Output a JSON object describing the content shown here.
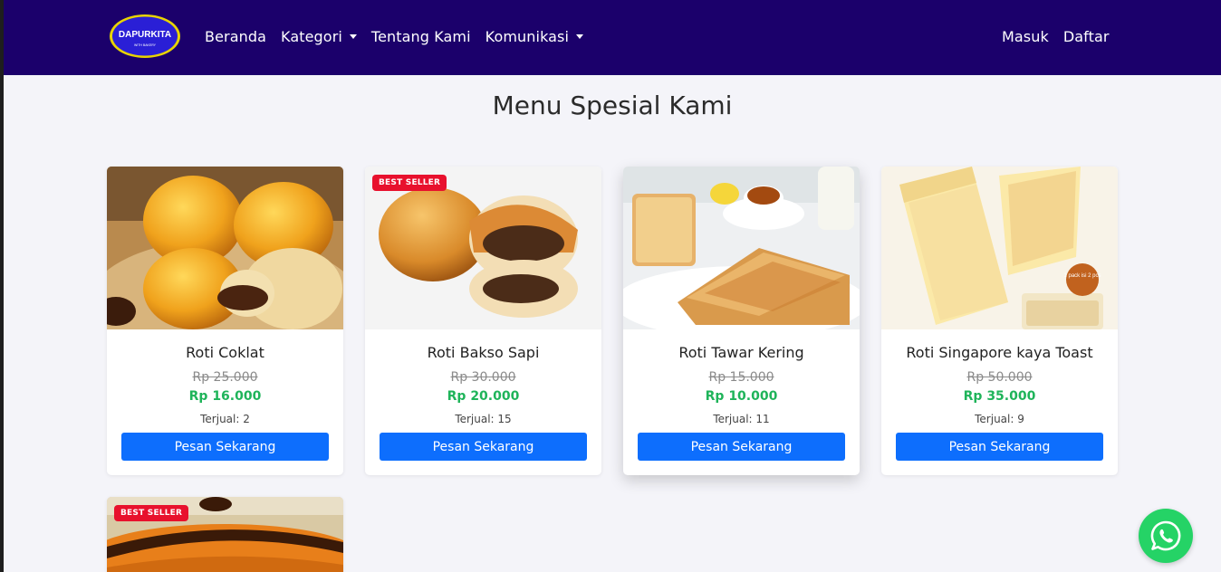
{
  "nav": {
    "logo_text": "DAPURKITA",
    "logo_sub": "WITH BAKERY",
    "links": [
      {
        "label": "Beranda"
      },
      {
        "label": "Kategori"
      },
      {
        "label": "Tentang Kami"
      },
      {
        "label": "Komunikasi"
      }
    ],
    "login": "Masuk",
    "register": "Daftar"
  },
  "page": {
    "title": "Menu Spesial Kami"
  },
  "products": [
    {
      "name": "Roti Coklat",
      "old_price": "Rp 25.000",
      "price": "Rp 16.000",
      "sold": "Terjual: 2",
      "button": "Pesan Sekarang",
      "badge": ""
    },
    {
      "name": "Roti Bakso Sapi",
      "old_price": "Rp 30.000",
      "price": "Rp 20.000",
      "sold": "Terjual: 15",
      "button": "Pesan Sekarang",
      "badge": "BEST SELLER"
    },
    {
      "name": "Roti Tawar Kering",
      "old_price": "Rp 15.000",
      "price": "Rp 10.000",
      "sold": "Terjual: 11",
      "button": "Pesan Sekarang",
      "badge": ""
    },
    {
      "name": "Roti Singapore kaya Toast",
      "old_price": "Rp 50.000",
      "price": "Rp 35.000",
      "sold": "Terjual: 9",
      "button": "Pesan Sekarang",
      "badge": ""
    },
    {
      "badge": "BEST SELLER"
    }
  ],
  "product_image_text": {
    "pack_label": "1 pack isi 2 pcs"
  },
  "colors": {
    "navbar": "#1b006b",
    "button": "#0d6efd",
    "price": "#1fb45a",
    "badge": "#e8112d",
    "whatsapp": "#25d366"
  },
  "icons": {
    "whatsapp": "whatsapp-icon"
  }
}
